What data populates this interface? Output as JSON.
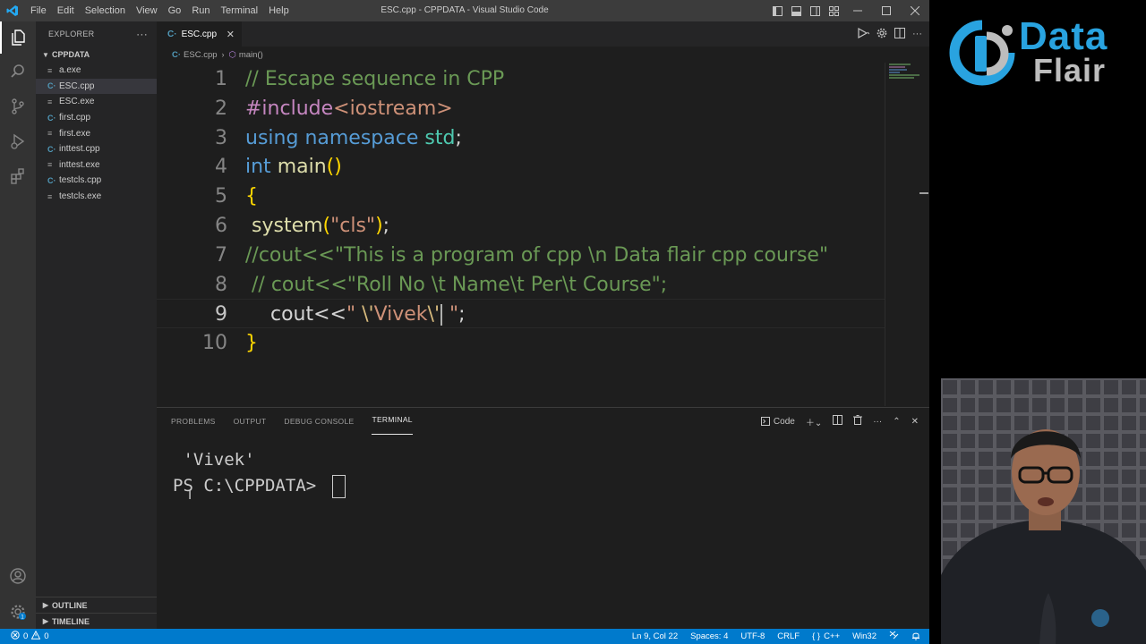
{
  "titlebar": {
    "menu": [
      "File",
      "Edit",
      "Selection",
      "View",
      "Go",
      "Run",
      "Terminal",
      "Help"
    ],
    "title": "ESC.cpp - CPPDATA - Visual Studio Code"
  },
  "explorer": {
    "header": "EXPLORER",
    "folder": "CPPDATA",
    "files": [
      {
        "name": "a.exe",
        "type": "exe"
      },
      {
        "name": "ESC.cpp",
        "type": "cpp",
        "selected": true
      },
      {
        "name": "ESC.exe",
        "type": "exe"
      },
      {
        "name": "first.cpp",
        "type": "cpp"
      },
      {
        "name": "first.exe",
        "type": "exe"
      },
      {
        "name": "inttest.cpp",
        "type": "cpp"
      },
      {
        "name": "inttest.exe",
        "type": "exe"
      },
      {
        "name": "testcls.cpp",
        "type": "cpp"
      },
      {
        "name": "testcls.exe",
        "type": "exe"
      }
    ],
    "outline": "OUTLINE",
    "timeline": "TIMELINE"
  },
  "editor": {
    "tab": "ESC.cpp",
    "breadcrumb_file": "ESC.cpp",
    "breadcrumb_symbol": "main()",
    "current_line": 9,
    "lines": [
      "// Escape sequence in CPP",
      "#include<iostream>",
      "using namespace std;",
      "int main()",
      "{",
      " system(\"cls\");",
      "//cout<<\"This is a program of cpp \\n Data flair cpp course\"",
      " // cout<<\"Roll No \\t Name\\t Per\\t Course\";",
      "    cout<<\" \\'Vivek\\' \";",
      "}"
    ]
  },
  "panel": {
    "tabs": [
      "PROBLEMS",
      "OUTPUT",
      "DEBUG CONSOLE",
      "TERMINAL"
    ],
    "active_tab": "TERMINAL",
    "terminal_profile": "Code",
    "terminal_lines": [
      " 'Vivek'",
      "PS C:\\CPPDATA> "
    ]
  },
  "statusbar": {
    "errors": "0",
    "warnings": "0",
    "position": "Ln 9, Col 22",
    "spaces": "Spaces: 4",
    "encoding": "UTF-8",
    "eol": "CRLF",
    "language": "C++",
    "platform": "Win32"
  },
  "brand": {
    "line1": "Data",
    "line2": "Flair"
  },
  "colors": {
    "accent": "#007acc",
    "brand_blue": "#29a3e0"
  }
}
